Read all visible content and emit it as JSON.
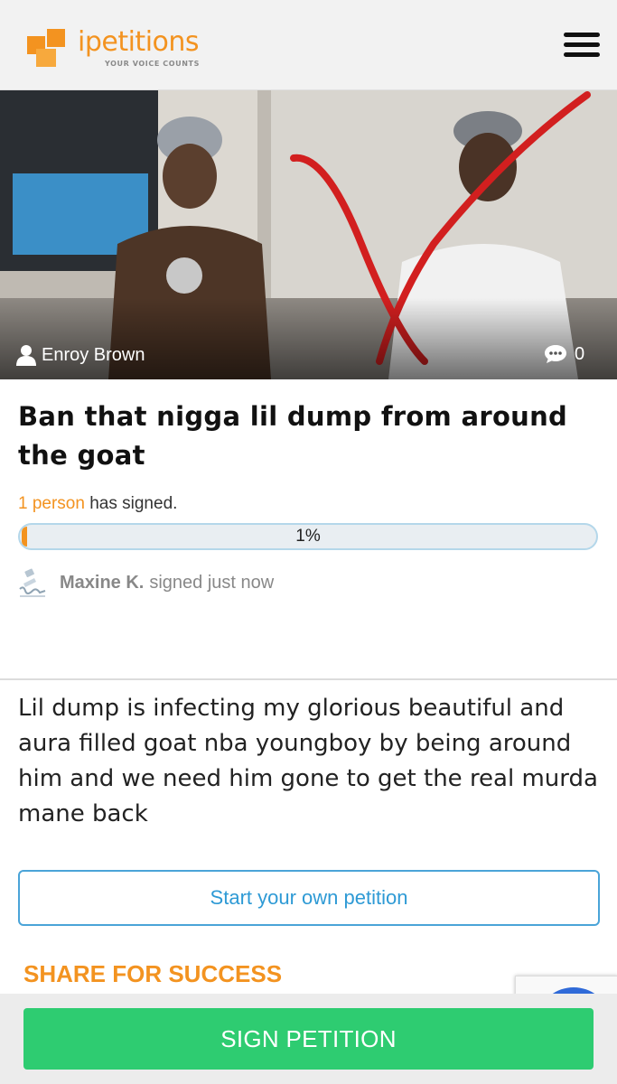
{
  "header": {
    "logo_name": "ipetitions",
    "logo_tagline": "YOUR VOICE COUNTS",
    "brand_color": "#f39320",
    "menu_icon": "hamburger-menu-icon"
  },
  "hero": {
    "author_name": "Enroy Brown",
    "author_icon": "user-icon",
    "comment_icon": "speech-bubble-icon",
    "comment_count": "0"
  },
  "petition": {
    "title": "Ban that nigga lil dump from around the goat",
    "signed_count": "1 person",
    "signed_suffix": "has signed.",
    "progress_label": "1%",
    "progress_value": 0.01,
    "recent_signer": "Maxine K.",
    "recent_text": "signed just now",
    "recent_icon": "signature-icon",
    "description": "Lil dump is infecting my glorious beautiful and aura filled goat nba youngboy by being around him and we need him gone to get the real murda mane back"
  },
  "actions": {
    "start_label": "Start your own petition",
    "share_heading": "SHARE FOR SUCCESS",
    "sign_label": "SIGN PETITION",
    "sign_color": "#2ecc71"
  }
}
